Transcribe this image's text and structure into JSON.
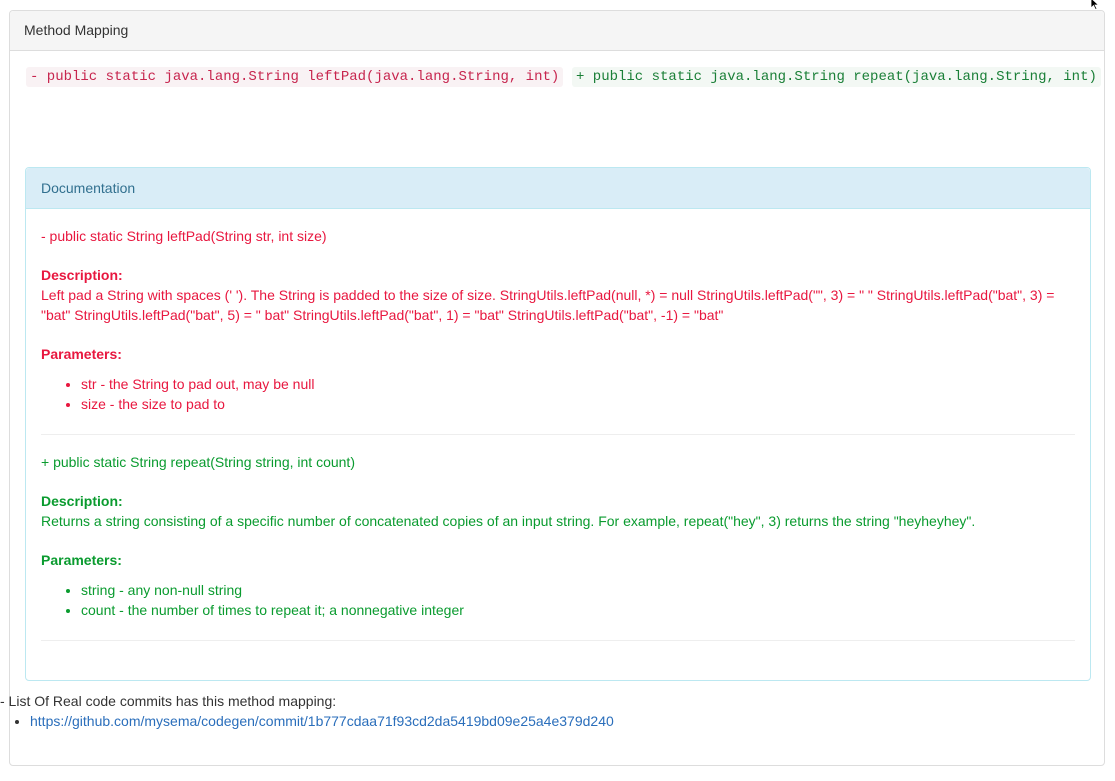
{
  "panel": {
    "title": "Method Mapping",
    "removed_signature": "- public static java.lang.String leftPad(java.lang.String, int)",
    "added_signature": "+ public static java.lang.String repeat(java.lang.String, int)"
  },
  "documentation": {
    "title": "Documentation",
    "old": {
      "signature": "- public static String leftPad(String str, int size)",
      "description_label": "Description:",
      "description": "Left pad a String with spaces (' '). The String is padded to the size of size. StringUtils.leftPad(null, *) = null StringUtils.leftPad(\"\", 3) = \" \" StringUtils.leftPad(\"bat\", 3) = \"bat\" StringUtils.leftPad(\"bat\", 5) = \" bat\" StringUtils.leftPad(\"bat\", 1) = \"bat\" StringUtils.leftPad(\"bat\", -1) = \"bat\"",
      "parameters_label": "Parameters:",
      "parameters": [
        "str - the String to pad out, may be null",
        "size - the size to pad to"
      ]
    },
    "new": {
      "signature": "+ public static String repeat(String string, int count)",
      "description_label": "Description:",
      "description": "Returns a string consisting of a specific number of concatenated copies of an input string. For example, repeat(\"hey\", 3) returns the string \"heyheyhey\".",
      "parameters_label": "Parameters:",
      "parameters": [
        "string - any non-null string",
        "count - the number of times to repeat it; a nonnegative integer"
      ]
    }
  },
  "commits": {
    "label": "- List Of Real code commits has this method mapping:",
    "links": [
      "https://github.com/mysema/codegen/commit/1b777cdaa71f93cd2da5419bd09e25a4e379d240"
    ]
  },
  "colors": {
    "removed": "#e8173f",
    "added": "#0a9b2f",
    "link": "#2a6ebb",
    "info_heading_bg": "#d9edf7"
  },
  "icons": {
    "cursor": "mouse-pointer-icon"
  }
}
